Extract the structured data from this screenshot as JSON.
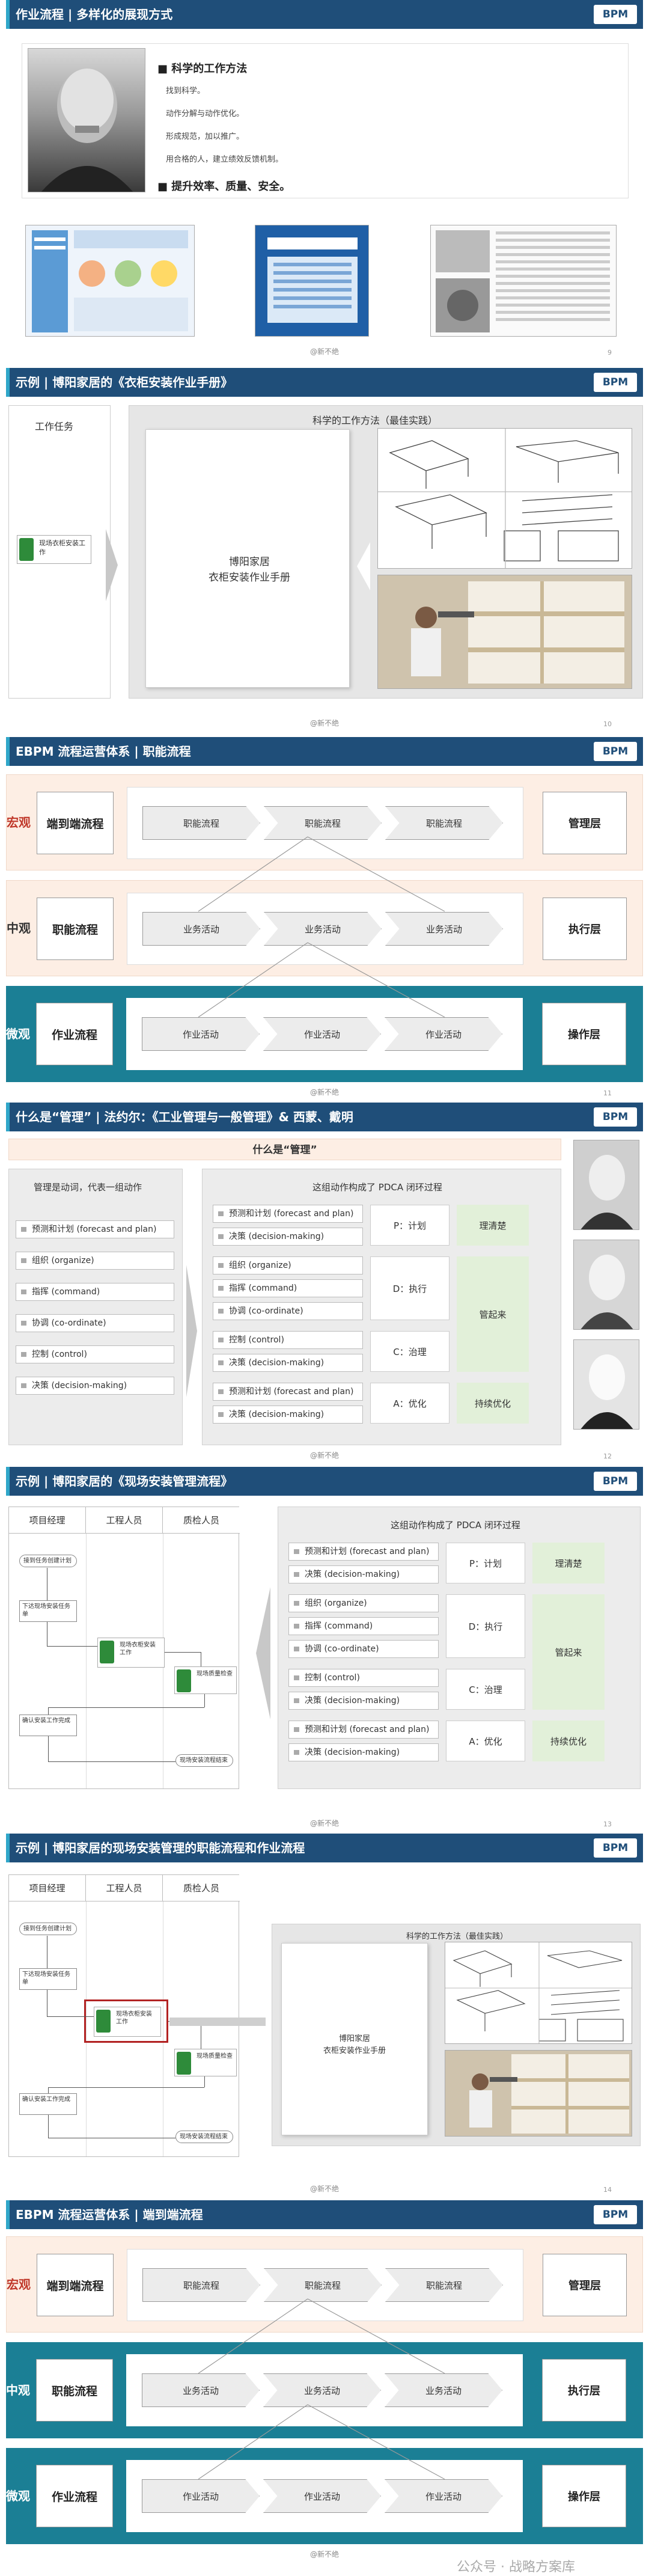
{
  "slide1": {
    "header": "作业流程 | 多样化的展现方式",
    "logo": "BPM",
    "title": "科学的工作方法",
    "bullets": [
      "找到科学。",
      "动作分解与动作优化。",
      "形成规范，加以推广。",
      "用合格的人，建立绩效反馈机制。"
    ],
    "emph": "提升效率、质量、安全。",
    "footer": "@新不绝",
    "page": "9"
  },
  "slide2": {
    "header": "示例 | 博阳家居的《衣柜安装作业手册》",
    "logo": "BPM",
    "task_label": "工作任务",
    "task": "现场衣柜安装工作",
    "panel_title": "科学的工作方法（最佳实践）",
    "manual": "博阳家居\n衣柜安装作业手册",
    "footer": "@新不绝",
    "page": "10"
  },
  "slide3": {
    "header": "EBPM 流程运营体系 | 职能流程",
    "logo": "BPM",
    "rows": [
      {
        "side": "宏观",
        "left": "端到端流程",
        "right": "管理层",
        "steps": [
          "职能流程",
          "职能流程",
          "职能流程"
        ]
      },
      {
        "side": "中观",
        "left": "职能流程",
        "right": "执行层",
        "steps": [
          "业务活动",
          "业务活动",
          "业务活动"
        ]
      },
      {
        "side": "微观",
        "left": "作业流程",
        "right": "操作层",
        "steps": [
          "作业活动",
          "作业活动",
          "作业活动"
        ]
      }
    ],
    "footer": "@新不绝",
    "page": "11"
  },
  "slide4": {
    "header": "什么是“管理” | 法约尔：《工业管理与一般管理》& 西蒙、戴明",
    "logo": "BPM",
    "banner": "什么是“管理”",
    "left_title": "管理是动词，代表一组动作",
    "left_items": [
      "预测和计划 (forecast and plan)",
      "组织 (organize)",
      "指挥 (command)",
      "协调 (co-ordinate)",
      "控制 (control)",
      "决策 (decision-making)"
    ],
    "right_title": "这组动作构成了 PDCA 闭环过程",
    "right_items": [
      "预测和计划 (forecast and plan)",
      "决策 (decision-making)",
      "组织 (organize)",
      "指挥 (command)",
      "协调 (co-ordinate)",
      "控制 (control)",
      "决策 (decision-making)",
      "预测和计划 (forecast and plan)",
      "决策 (decision-making)"
    ],
    "pdca": [
      "P：计划",
      "D：执行",
      "C：治理",
      "A：优化"
    ],
    "outcomes": [
      "理清楚",
      "管起来",
      "持续优化"
    ],
    "footer": "@新不绝",
    "page": "12"
  },
  "slide5": {
    "header": "示例 | 博阳家居的《现场安装管理流程》",
    "logo": "BPM",
    "roles": [
      "项目经理",
      "工程人员",
      "质检人员"
    ],
    "flow": [
      "接到任务创建计划",
      "下达现场安装任务单",
      "现场衣柜安装工作",
      "现场质量检查",
      "确认安装工作完成",
      "现场安装流程结束"
    ],
    "right_title": "这组动作构成了 PDCA 闭环过程",
    "right_items": [
      "预测和计划 (forecast and plan)",
      "决策 (decision-making)",
      "组织 (organize)",
      "指挥 (command)",
      "协调 (co-ordinate)",
      "控制 (control)",
      "决策 (decision-making)",
      "预测和计划 (forecast and plan)",
      "决策 (decision-making)"
    ],
    "pdca": [
      "P：计划",
      "D：执行",
      "C：治理",
      "A：优化"
    ],
    "outcomes": [
      "理清楚",
      "管起来",
      "持续优化"
    ],
    "footer": "@新不绝",
    "page": "13"
  },
  "slide6": {
    "header": "示例 | 博阳家居的现场安装管理的职能流程和作业流程",
    "logo": "BPM",
    "roles": [
      "项目经理",
      "工程人员",
      "质检人员"
    ],
    "flow": [
      "接到任务创建计划",
      "下达现场安装任务单",
      "现场衣柜安装工作",
      "现场质量检查",
      "确认安装工作完成",
      "现场安装流程结束"
    ],
    "panel_title": "科学的工作方法（最佳实践）",
    "manual": "博阳家居\n衣柜安装作业手册",
    "footer": "@新不绝",
    "page": "14"
  },
  "slide7": {
    "header": "EBPM 流程运营体系 | 端到端流程",
    "logo": "BPM",
    "rows": [
      {
        "side": "宏观",
        "left": "端到端流程",
        "right": "管理层",
        "steps": [
          "职能流程",
          "职能流程",
          "职能流程"
        ]
      },
      {
        "side": "中观",
        "left": "职能流程",
        "right": "执行层",
        "steps": [
          "业务活动",
          "业务活动",
          "业务活动"
        ]
      },
      {
        "side": "微观",
        "left": "作业流程",
        "right": "操作层",
        "steps": [
          "作业活动",
          "作业活动",
          "作业活动"
        ]
      }
    ],
    "footer": "@新不绝",
    "watermark": "公众号 · 战略方案库"
  },
  "colors": {
    "navy": "#1f4e79",
    "teal": "#1b7f95",
    "peach": "#fdeee4",
    "green": "#2e8b3a"
  }
}
